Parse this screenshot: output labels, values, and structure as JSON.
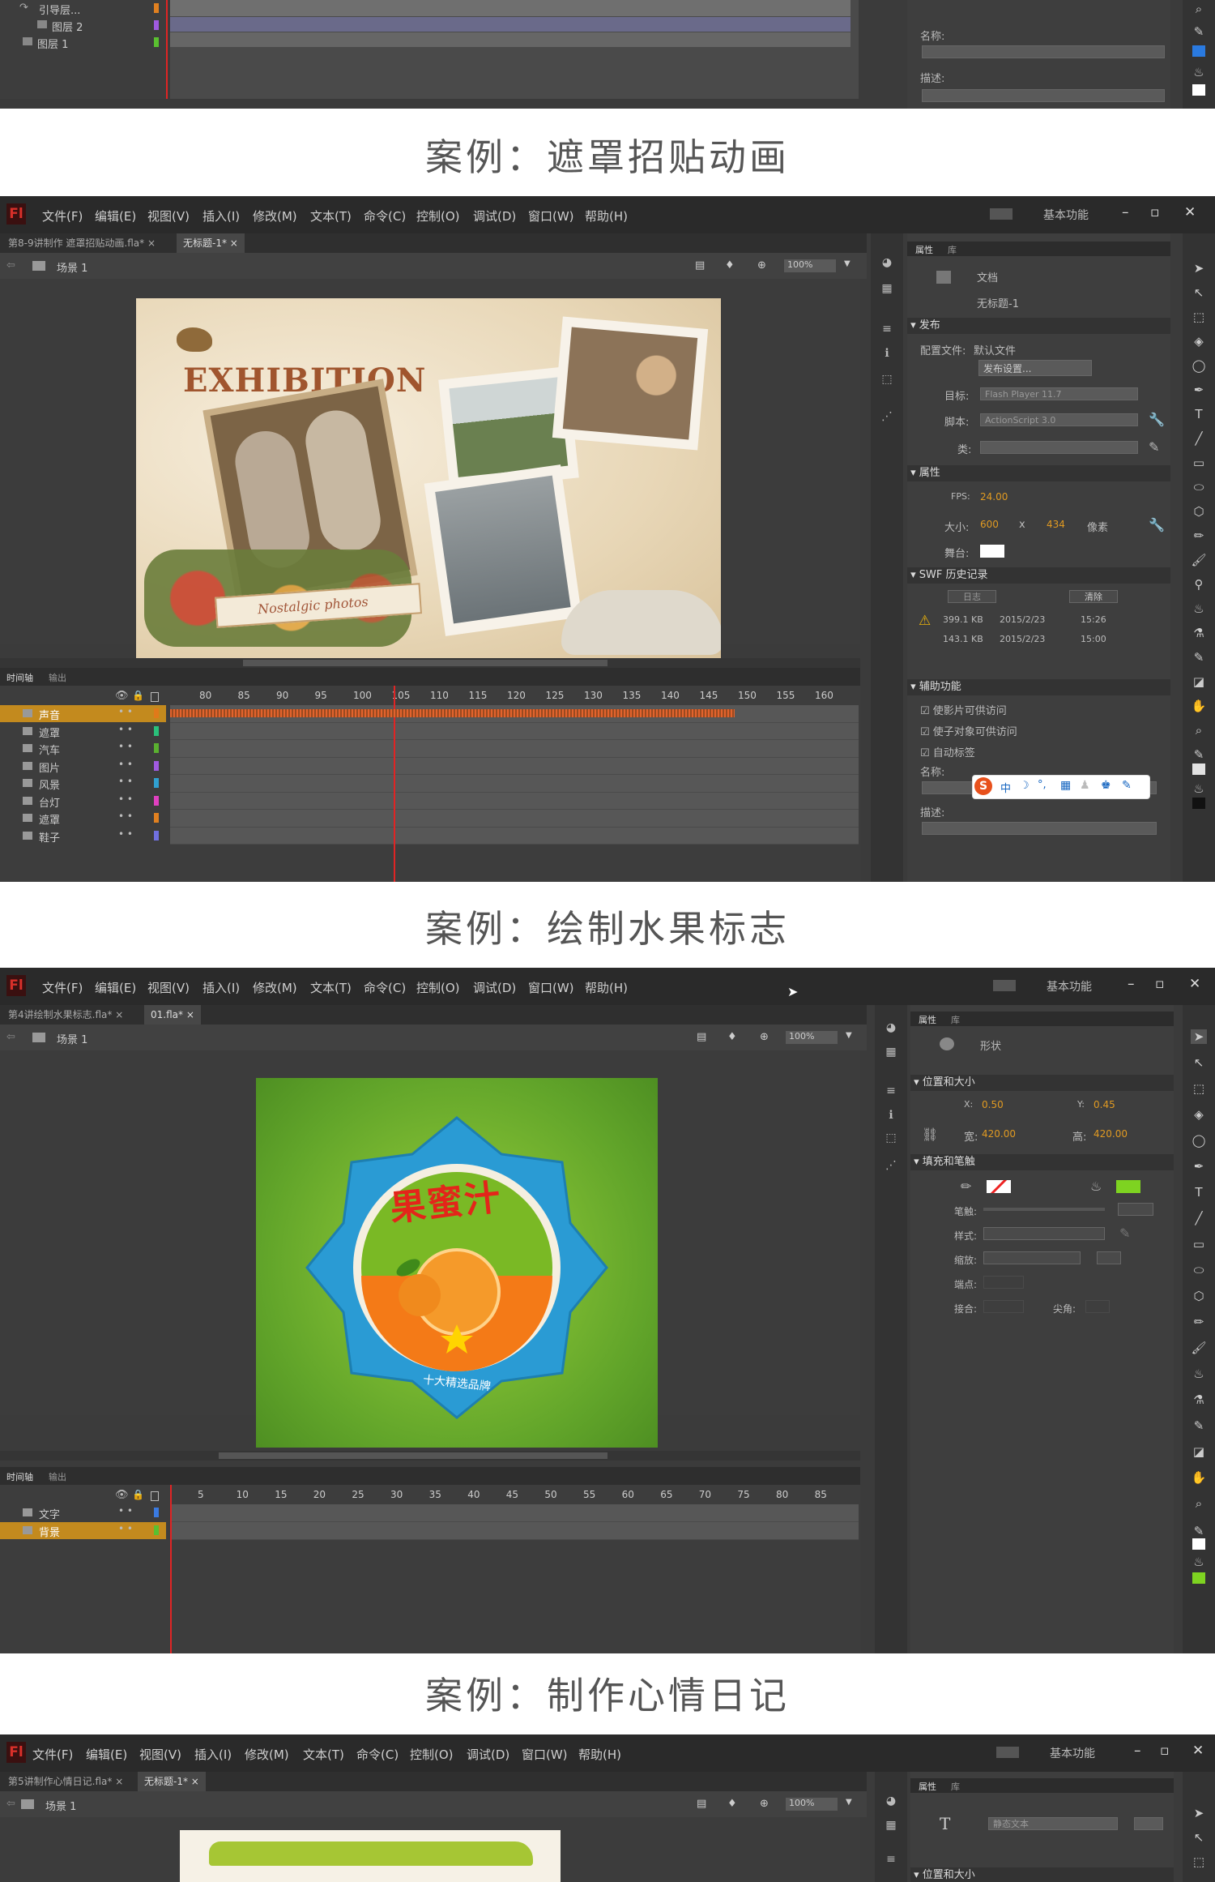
{
  "captions": [
    "案例：遮罩招贴动画",
    "案例：绘制水果标志",
    "案例：制作心情日记"
  ],
  "menu": [
    "文件(F)",
    "编辑(E)",
    "视图(V)",
    "插入(I)",
    "修改(M)",
    "文本(T)",
    "命令(C)",
    "控制(O)",
    "调试(D)",
    "窗口(W)",
    "帮助(H)"
  ],
  "app_logo": "Fl",
  "workspace": "基本功能",
  "shot0": {
    "layers": [
      "引导层...",
      "图层 2",
      "图层 1"
    ],
    "name_label": "名称:",
    "desc_label": "描述:"
  },
  "shot1": {
    "tabs": [
      "第8-9讲制作 遮罩招贴动画.fla*",
      "无标题-1*"
    ],
    "scene": "场景 1",
    "zoom": "100%",
    "timeline_tabs": [
      "时间轴",
      "输出"
    ],
    "ruler": [
      "80",
      "85",
      "90",
      "95",
      "100",
      "105",
      "110",
      "115",
      "120",
      "125",
      "130",
      "135",
      "140",
      "145",
      "150",
      "155",
      "160"
    ],
    "layers": [
      {
        "name": "声音",
        "selected": true,
        "color": "#e07a1a"
      },
      {
        "name": "遮罩",
        "selected": false,
        "color": "#2ac07a"
      },
      {
        "name": "汽车",
        "selected": false,
        "color": "#5ab030"
      },
      {
        "name": "图片",
        "selected": false,
        "color": "#a05ae0"
      },
      {
        "name": "风景",
        "selected": false,
        "color": "#30a0d0"
      },
      {
        "name": "台灯",
        "selected": false,
        "color": "#e040c0"
      },
      {
        "name": "遮罩",
        "selected": false,
        "color": "#e08020"
      },
      {
        "name": "鞋子",
        "selected": false,
        "color": "#7070e0"
      }
    ],
    "poster": {
      "title": "EXHIBITION",
      "ribbon": "Nostalgic photos"
    },
    "props": {
      "tabs": [
        "属性",
        "库"
      ],
      "doc_type": "文档",
      "doc_name": "无标题-1",
      "publish_section": "发布",
      "profile_label": "配置文件:",
      "profile_value": "默认文件",
      "publish_settings": "发布设置...",
      "target_label": "目标:",
      "target_value": "Flash Player 11.7",
      "script_label": "脚本:",
      "script_value": "ActionScript 3.0",
      "class_label": "类:",
      "props_section": "属性",
      "fps_label": "FPS:",
      "fps_value": "24.00",
      "size_label": "大小:",
      "width": "600",
      "x_sep": "x",
      "height": "434",
      "unit": "像素",
      "stage_label": "舞台:",
      "swf_section": "SWF 历史记录",
      "log_btn": "日志",
      "clear_btn": "清除",
      "history": [
        {
          "size": "399.1 KB",
          "date": "2015/2/23",
          "time": "15:26"
        },
        {
          "size": "143.1 KB",
          "date": "2015/2/23",
          "time": "15:00"
        }
      ],
      "access_section": "辅助功能",
      "chk1": "使影片可供访问",
      "chk2": "使子对象可供访问",
      "chk3": "自动标签",
      "name_label": "名称:",
      "desc_label": "描述:",
      "ime": [
        "S",
        "中",
        "☽",
        "°,",
        "▦",
        "♟",
        "♚",
        "✎"
      ]
    }
  },
  "shot2": {
    "tabs": [
      "第4讲绘制水果标志.fla*",
      "01.fla*"
    ],
    "scene": "场景 1",
    "zoom": "100%",
    "timeline_tabs": [
      "时间轴",
      "输出"
    ],
    "ruler": [
      "5",
      "10",
      "15",
      "20",
      "25",
      "30",
      "35",
      "40",
      "45",
      "50",
      "55",
      "60",
      "65",
      "70",
      "75",
      "80",
      "85"
    ],
    "layers": [
      {
        "name": "文字",
        "selected": false,
        "color": "#3a7ae0"
      },
      {
        "name": "背景",
        "selected": true,
        "color": "#5ac030"
      }
    ],
    "logo": {
      "title": "果蜜汁",
      "sub": "十大精选品牌"
    },
    "props": {
      "tabs": [
        "属性",
        "库"
      ],
      "type": "形状",
      "pos_section": "位置和大小",
      "x_label": "X:",
      "x_value": "0.50",
      "y_label": "Y:",
      "y_value": "0.45",
      "w_label": "宽:",
      "w_value": "420.00",
      "h_label": "高:",
      "h_value": "420.00",
      "fill_section": "填充和笔触",
      "stroke_label": "笔触:",
      "style_label": "样式:",
      "scale_label": "缩放:",
      "cap_label": "端点:",
      "join_label": "接合:",
      "tip_label": "尖角:",
      "fill_color": "#7ed321"
    }
  },
  "shot3": {
    "tabs": [
      "第5讲制作心情日记.fla*",
      "无标题-1*"
    ],
    "scene": "场景 1",
    "zoom": "100%",
    "props": {
      "tabs": [
        "属性",
        "库"
      ],
      "text_type": "静态文本",
      "pos_section": "位置和大小"
    }
  }
}
